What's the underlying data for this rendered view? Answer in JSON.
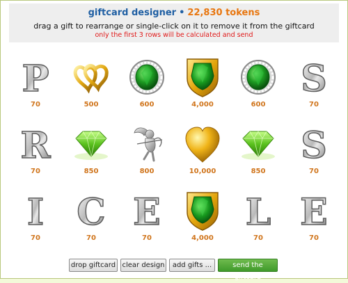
{
  "header": {
    "title": "giftcard designer",
    "separator": "•",
    "tokens": "22,830 tokens",
    "instructions": "drag a gift to rearrange or single-click on it to remove it from the giftcard",
    "warning": "only the first 3 rows will be calculated and send"
  },
  "colors": {
    "title": "#1f5fa3",
    "tokens": "#e8760f",
    "value": "#d0751c",
    "warning": "#e01818",
    "primary_button": "#4fa836"
  },
  "grid": {
    "rows": [
      [
        {
          "icon": "letter-p-icon",
          "glyph": "P",
          "value": "70"
        },
        {
          "icon": "gold-rings-icon",
          "value": "500"
        },
        {
          "icon": "emerald-ring-icon",
          "value": "600"
        },
        {
          "icon": "emerald-shield-icon",
          "value": "4,000"
        },
        {
          "icon": "emerald-ring-icon",
          "value": "600"
        },
        {
          "icon": "letter-s-icon",
          "glyph": "S",
          "value": "70"
        }
      ],
      [
        {
          "icon": "letter-r-icon",
          "glyph": "R",
          "value": "70"
        },
        {
          "icon": "green-diamond-icon",
          "value": "850"
        },
        {
          "icon": "cupid-icon",
          "value": "800"
        },
        {
          "icon": "gold-heart-icon",
          "value": "10,000"
        },
        {
          "icon": "green-diamond-icon",
          "value": "850"
        },
        {
          "icon": "letter-s-icon",
          "glyph": "S",
          "value": "70"
        }
      ],
      [
        {
          "icon": "letter-i-icon",
          "glyph": "I",
          "value": "70"
        },
        {
          "icon": "letter-c-icon",
          "glyph": "C",
          "value": "70"
        },
        {
          "icon": "letter-e-icon",
          "glyph": "E",
          "value": "70"
        },
        {
          "icon": "emerald-shield-icon",
          "value": "4,000"
        },
        {
          "icon": "letter-l-icon",
          "glyph": "L",
          "value": "70"
        },
        {
          "icon": "letter-e-icon",
          "glyph": "E",
          "value": "70"
        }
      ]
    ]
  },
  "buttons": {
    "drop": "drop giftcard",
    "clear": "clear design",
    "add": "add gifts ...",
    "send": "send the giftcard"
  }
}
